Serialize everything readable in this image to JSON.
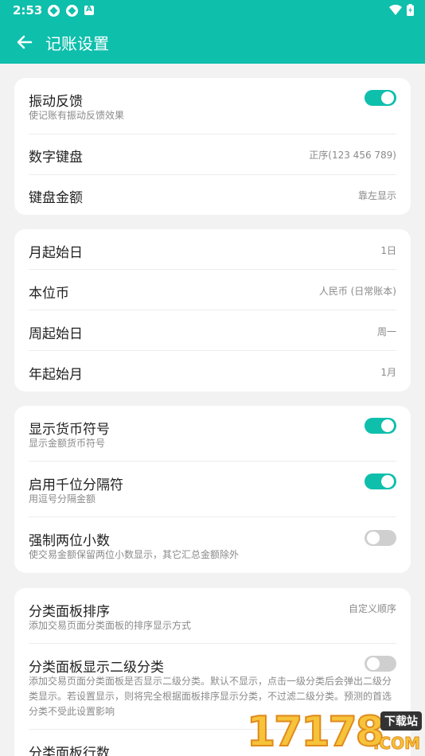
{
  "status_bar": {
    "time": "2:53"
  },
  "app_bar": {
    "title": "记账设置"
  },
  "card1": {
    "vibration": {
      "label": "振动反馈",
      "desc": "使记账有振动反馈效果",
      "enabled": true
    },
    "keyboard": {
      "label": "数字键盘",
      "value": "正序(123 456 789)"
    },
    "amount": {
      "label": "键盘金额",
      "value": "靠左显示"
    }
  },
  "card2": {
    "month_start": {
      "label": "月起始日",
      "value": "1日"
    },
    "base_currency": {
      "label": "本位币",
      "value": "人民币 (日常账本)"
    },
    "week_start": {
      "label": "周起始日",
      "value": "周一"
    },
    "year_start": {
      "label": "年起始月",
      "value": "1月"
    }
  },
  "card3": {
    "currency_symbol": {
      "label": "显示货币符号",
      "desc": "显示金额货币符号",
      "enabled": true
    },
    "thousands": {
      "label": "启用千位分隔符",
      "desc": "用逗号分隔金额",
      "enabled": true
    },
    "two_decimals": {
      "label": "强制两位小数",
      "desc": "使交易金额保留两位小数显示，其它汇总金额除外",
      "enabled": false
    }
  },
  "card4": {
    "panel_sort": {
      "label": "分类面板排序",
      "desc": "添加交易页面分类面板的排序显示方式",
      "value": "自定义顺序"
    },
    "panel_sub": {
      "label": "分类面板显示二级分类",
      "desc": "添加交易页面分类面板是否显示二级分类。默认不显示，点击一级分类后会弹出二级分类显示。若设置显示，则将完全根据面板排序显示分类，不过滤二级分类。预测的首选分类不受此设置影响",
      "enabled": false
    },
    "panel_rows": {
      "label": "分类面板行数"
    }
  },
  "watermark": {
    "number": "17178",
    "tag": "下载站",
    "domain": ".COM"
  },
  "colors": {
    "accent": "#0ebfac",
    "background": "#f2f2f2",
    "toggle_off": "#cfcfcf"
  }
}
